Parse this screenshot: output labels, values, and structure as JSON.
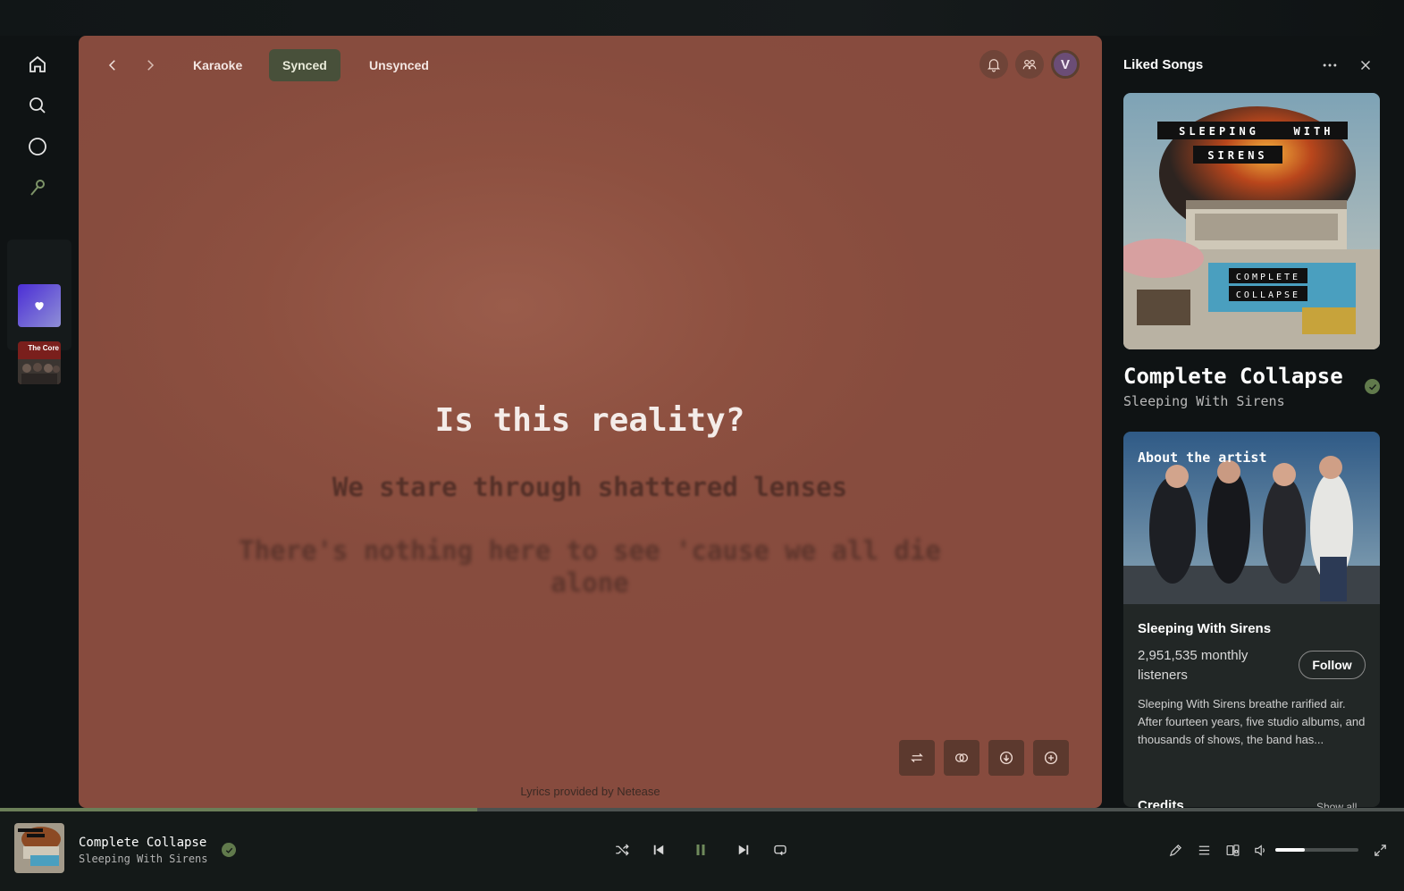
{
  "tabs": [
    {
      "label": "Karaoke"
    },
    {
      "label": "Synced"
    },
    {
      "label": "Unsynced"
    }
  ],
  "active_tab": "Synced",
  "user": {
    "avatar_initial": "V"
  },
  "lyrics": {
    "current": "Is this reality?",
    "next": "We stare through shattered lenses",
    "after_next": "There's nothing here to see 'cause we all die alone",
    "provider": "Lyrics provided by Netease"
  },
  "side_panel": {
    "title": "Liked Songs",
    "album_art_text": [
      "SLEEPING",
      "WITH",
      "SIRENS",
      "COMPLETE",
      "COLLAPSE"
    ],
    "track_title": "Complete Collapse",
    "track_artist": "Sleeping With Sirens",
    "about": {
      "label": "About the artist",
      "artist_name": "Sleeping With Sirens",
      "listeners": "2,951,535 monthly listeners",
      "follow_label": "Follow",
      "bio": "Sleeping With Sirens breathe rarified air. After fourteen years, five studio albums, and thousands of shows, the band has..."
    },
    "credits_label": "Credits",
    "show_all_label": "Show all"
  },
  "sidebar_thumbs": {
    "core_text": "The Core"
  },
  "now_playing": {
    "title": "Complete Collapse",
    "artist": "Sleeping With Sirens",
    "progress": 0.34,
    "volume": 0.36
  },
  "icons": {
    "rail": [
      "home-icon",
      "search-icon",
      "circle-icon",
      "microphone-icon",
      "library-icon"
    ],
    "header": [
      "bell-icon",
      "friends-icon"
    ],
    "lyrics_controls": [
      "translate-icon",
      "compare-icon",
      "download-icon",
      "add-icon"
    ],
    "player": [
      "shuffle-icon",
      "previous-icon",
      "pause-icon",
      "next-icon",
      "repeat-icon"
    ],
    "right_controls": [
      "lyrics-pen-icon",
      "queue-icon",
      "connect-device-icon",
      "volume-icon",
      "fullscreen-icon"
    ]
  },
  "colors": {
    "lyrics_bg": "#8d5040",
    "accent_green": "#617a4c",
    "active_tab_bg": "#48503a"
  }
}
